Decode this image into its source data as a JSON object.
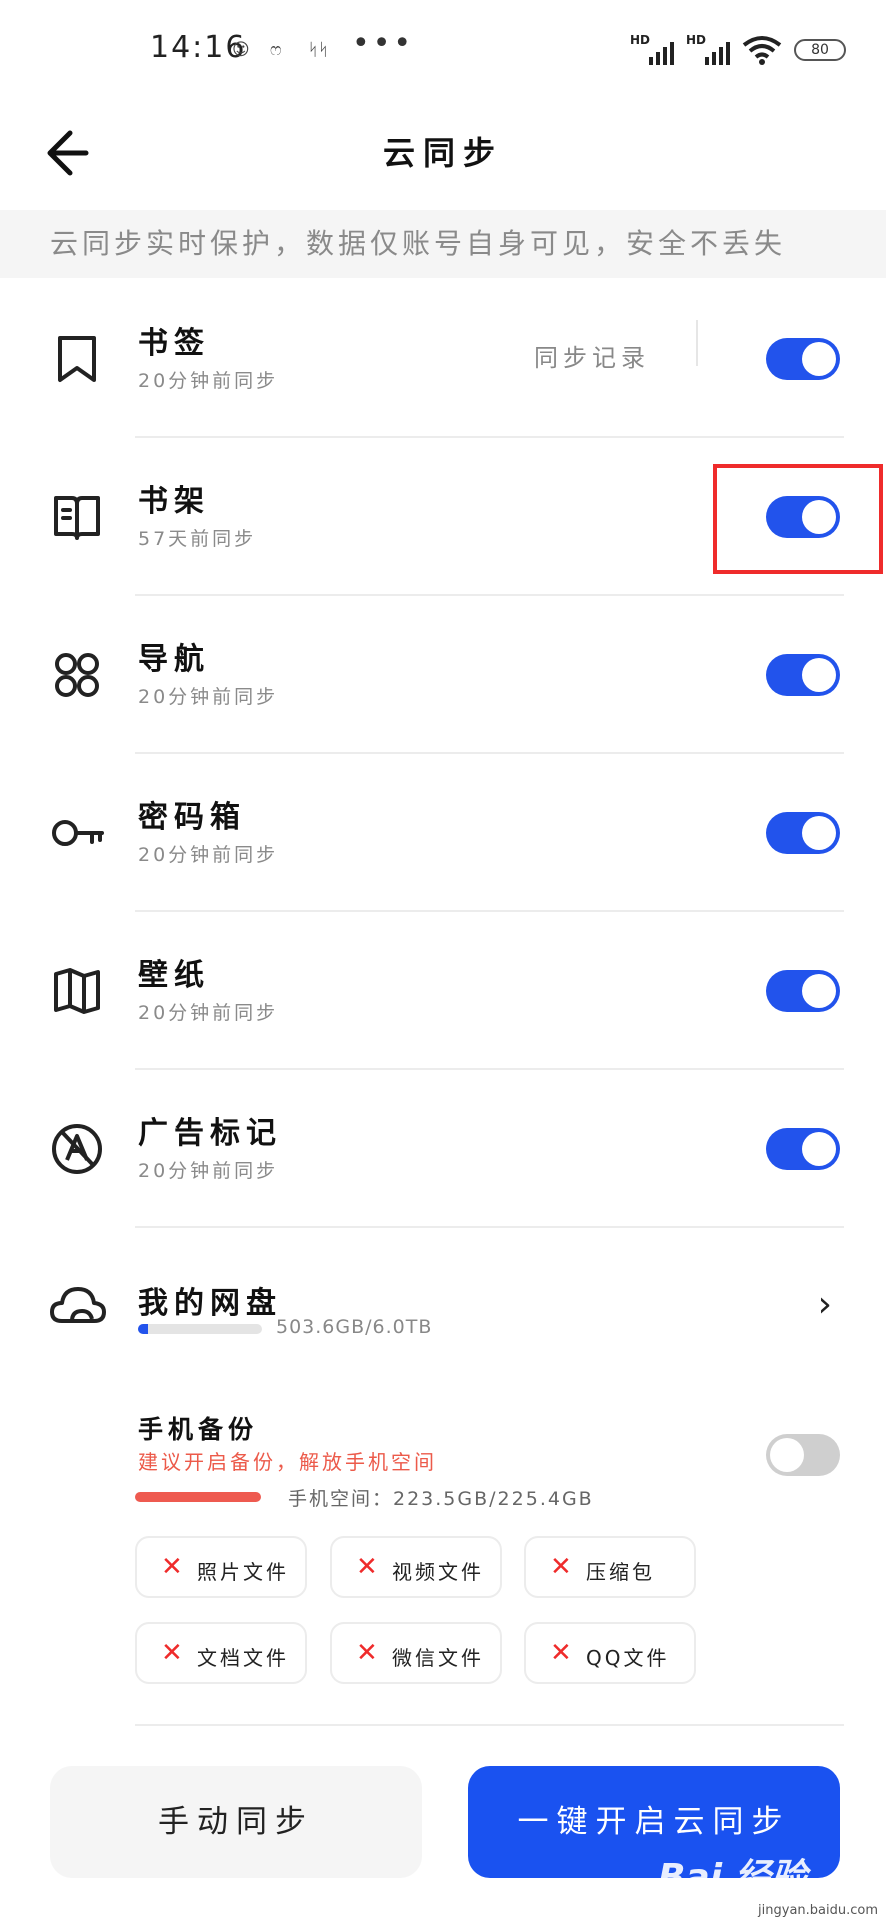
{
  "status_bar": {
    "time": "14:16",
    "notif_1": "☺",
    "notif_2": "ෆ",
    "notif_3": "ᛋᛋ",
    "more": "•••",
    "sim1": "HD",
    "sim2": "HD",
    "battery": "80"
  },
  "header": {
    "title": "云同步"
  },
  "notice": "云同步实时保护，数据仅账号自身可见，安全不丢失",
  "sync_items": [
    {
      "label": "书签",
      "subtitle": "20分钟前同步",
      "on": true
    },
    {
      "label": "书架",
      "subtitle": "57天前同步",
      "on": true
    },
    {
      "label": "导航",
      "subtitle": "20分钟前同步",
      "on": true
    },
    {
      "label": "密码箱",
      "subtitle": "20分钟前同步",
      "on": true
    },
    {
      "label": "壁纸",
      "subtitle": "20分钟前同步",
      "on": true
    },
    {
      "label": "广告标记",
      "subtitle": "20分钟前同步",
      "on": true
    }
  ],
  "sync_record_label": "同步记录",
  "netdisk": {
    "label": "我的网盘",
    "usage": "503.6GB/6.0TB",
    "usage_fraction": 0.08
  },
  "phone_backup": {
    "title": "手机备份",
    "warning": "建议开启备份，解放手机空间",
    "space": "手机空间：223.5GB/225.4GB",
    "space_fraction": 0.99,
    "enabled": false,
    "types": [
      "照片文件",
      "视频文件",
      "压缩包",
      "文档文件",
      "微信文件",
      "QQ文件"
    ]
  },
  "buttons": {
    "manual": "手动同步",
    "one_key": "一键开启云同步"
  },
  "watermark": {
    "brand": "Bai 经验",
    "url": "jingyan.baidu.com"
  },
  "colors": {
    "accent": "#2253ec",
    "warning": "#ec5a4a",
    "highlight": "#ef2b2b"
  },
  "icons": [
    "bookmark-icon",
    "bookshelf-icon",
    "navigation-icon",
    "key-icon",
    "wallpaper-icon",
    "ad-mark-icon",
    "cloud-icon",
    "chevron-right-icon",
    "close-x-icon"
  ]
}
